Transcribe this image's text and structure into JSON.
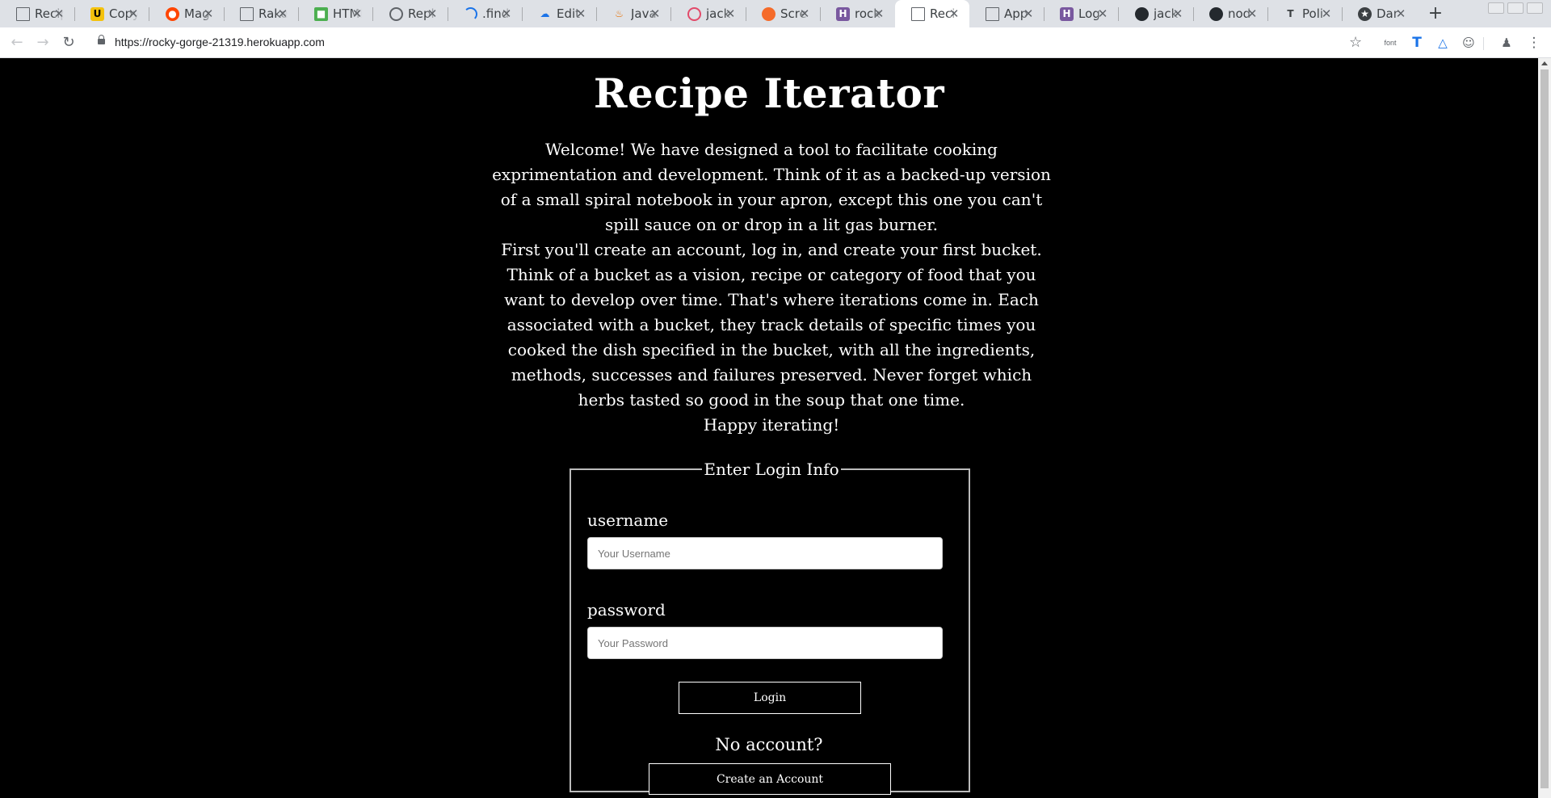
{
  "browser": {
    "tabs": [
      {
        "label": "Recipe",
        "favicon": "doc-icon"
      },
      {
        "label": "Copy",
        "favicon": "u-icon"
      },
      {
        "label": "Mag",
        "favicon": "reddit-icon"
      },
      {
        "label": "Rake",
        "favicon": "doc-icon"
      },
      {
        "label": "HTML",
        "favicon": "html-icon"
      },
      {
        "label": "Repl",
        "favicon": "circle-icon"
      },
      {
        "label": ".find",
        "favicon": "arc-icon"
      },
      {
        "label": "Edit",
        "favicon": "cloud-icon"
      },
      {
        "label": "Java",
        "favicon": "java-icon"
      },
      {
        "label": "jack",
        "favicon": "ring-icon"
      },
      {
        "label": "Scre",
        "favicon": "orange-icon"
      },
      {
        "label": "rock",
        "favicon": "heroku-icon"
      },
      {
        "label": "Reci",
        "favicon": "doc-icon",
        "active": true
      },
      {
        "label": "App",
        "favicon": "doc-icon"
      },
      {
        "label": "Log",
        "favicon": "heroku-icon"
      },
      {
        "label": "jack",
        "favicon": "github-icon"
      },
      {
        "label": "nod",
        "favicon": "github-icon"
      },
      {
        "label": "Poli",
        "favicon": "t-icon"
      },
      {
        "label": "Dar",
        "favicon": "star-icon"
      }
    ],
    "url": "https://rocky-gorge-21319.herokuapp.com",
    "extension_font_label": "font"
  },
  "page": {
    "title": "Recipe Iterator",
    "intro_paragraphs": [
      "Welcome! We have designed a tool to facilitate cooking exprimentation and development. Think of it as a backed-up version of a small spiral notebook in your apron, except this one you can't spill sauce on or drop in a lit gas burner.",
      "First you'll create an account, log in, and create your first bucket. Think of a bucket as a vision, recipe or category of food that you want to develop over time. That's where iterations come in. Each associated with a bucket, they track details of specific times you cooked the dish specified in the bucket, with all the ingredients, methods, successes and failures preserved. Never forget which herbs tasted so good in the soup that one time.",
      "Happy iterating!"
    ],
    "login": {
      "legend": "Enter Login Info",
      "username_label": "username",
      "username_placeholder": "Your Username",
      "password_label": "password",
      "password_placeholder": "Your Password",
      "submit_label": "Login"
    },
    "no_account_text": "No account?",
    "create_account_label": "Create an Account"
  }
}
